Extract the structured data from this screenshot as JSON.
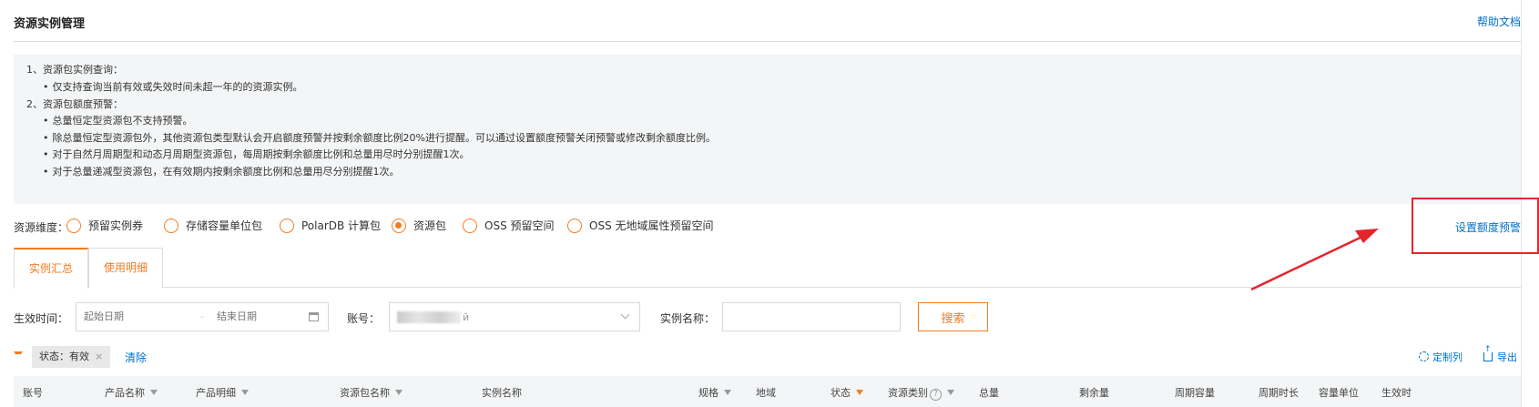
{
  "header": {
    "title": "资源实例管理",
    "help_link": "帮助文档"
  },
  "notice": {
    "lines": [
      "1、资源包实例查询：",
      "仅支持查询当前有效或失效时间未超一年的的资源实例。",
      "2、资源包额度预警：",
      "总量恒定型资源包不支持预警。",
      "除总量恒定型资源包外，其他资源包类型默认会开启额度预警并按剩余额度比例20%进行提醒。可以通过设置额度预警关闭预警或修改剩余额度比例。",
      "对于自然月周期型和动态月周期型资源包，每周期按剩余额度比例和总量用尽时分别提醒1次。",
      "对于总量递减型资源包，在有效期内按剩余额度比例和总量用尽分别提醒1次。"
    ]
  },
  "dimension": {
    "label": "资源维度：",
    "options": [
      "预留实例券",
      "存储容量单位包",
      "PolarDB 计算包",
      "资源包",
      "OSS 预留空间",
      "OSS 无地域属性预留空间"
    ],
    "selected": "资源包",
    "set_alert": "设置额度预警"
  },
  "tabs": [
    "实例汇总",
    "使用明细"
  ],
  "active_tab": "实例汇总",
  "filters": {
    "effective_time_label": "生效时间：",
    "start_placeholder": "起始日期",
    "separator": "-",
    "end_placeholder": "结束日期",
    "account_label": "账号：",
    "account_value_suffix": "й",
    "instance_name_label": "实例名称：",
    "instance_name_value": "",
    "search_button": "搜索"
  },
  "active_filter": {
    "tag": "状态：有效",
    "close": "×",
    "clear": "清除",
    "customize_columns": "定制列",
    "export": "导出"
  },
  "table": {
    "columns": [
      "账号",
      "产品名称",
      "产品明细",
      "资源包名称",
      "实例名称",
      "规格",
      "地域",
      "状态",
      "资源类别",
      "总量",
      "剩余量",
      "周期容量",
      "周期时长",
      "容量单位",
      "生效时"
    ],
    "help_mark": "?"
  },
  "colors": {
    "accent": "#f47b20",
    "link": "#0070cc",
    "annotation": "#e3262d"
  }
}
